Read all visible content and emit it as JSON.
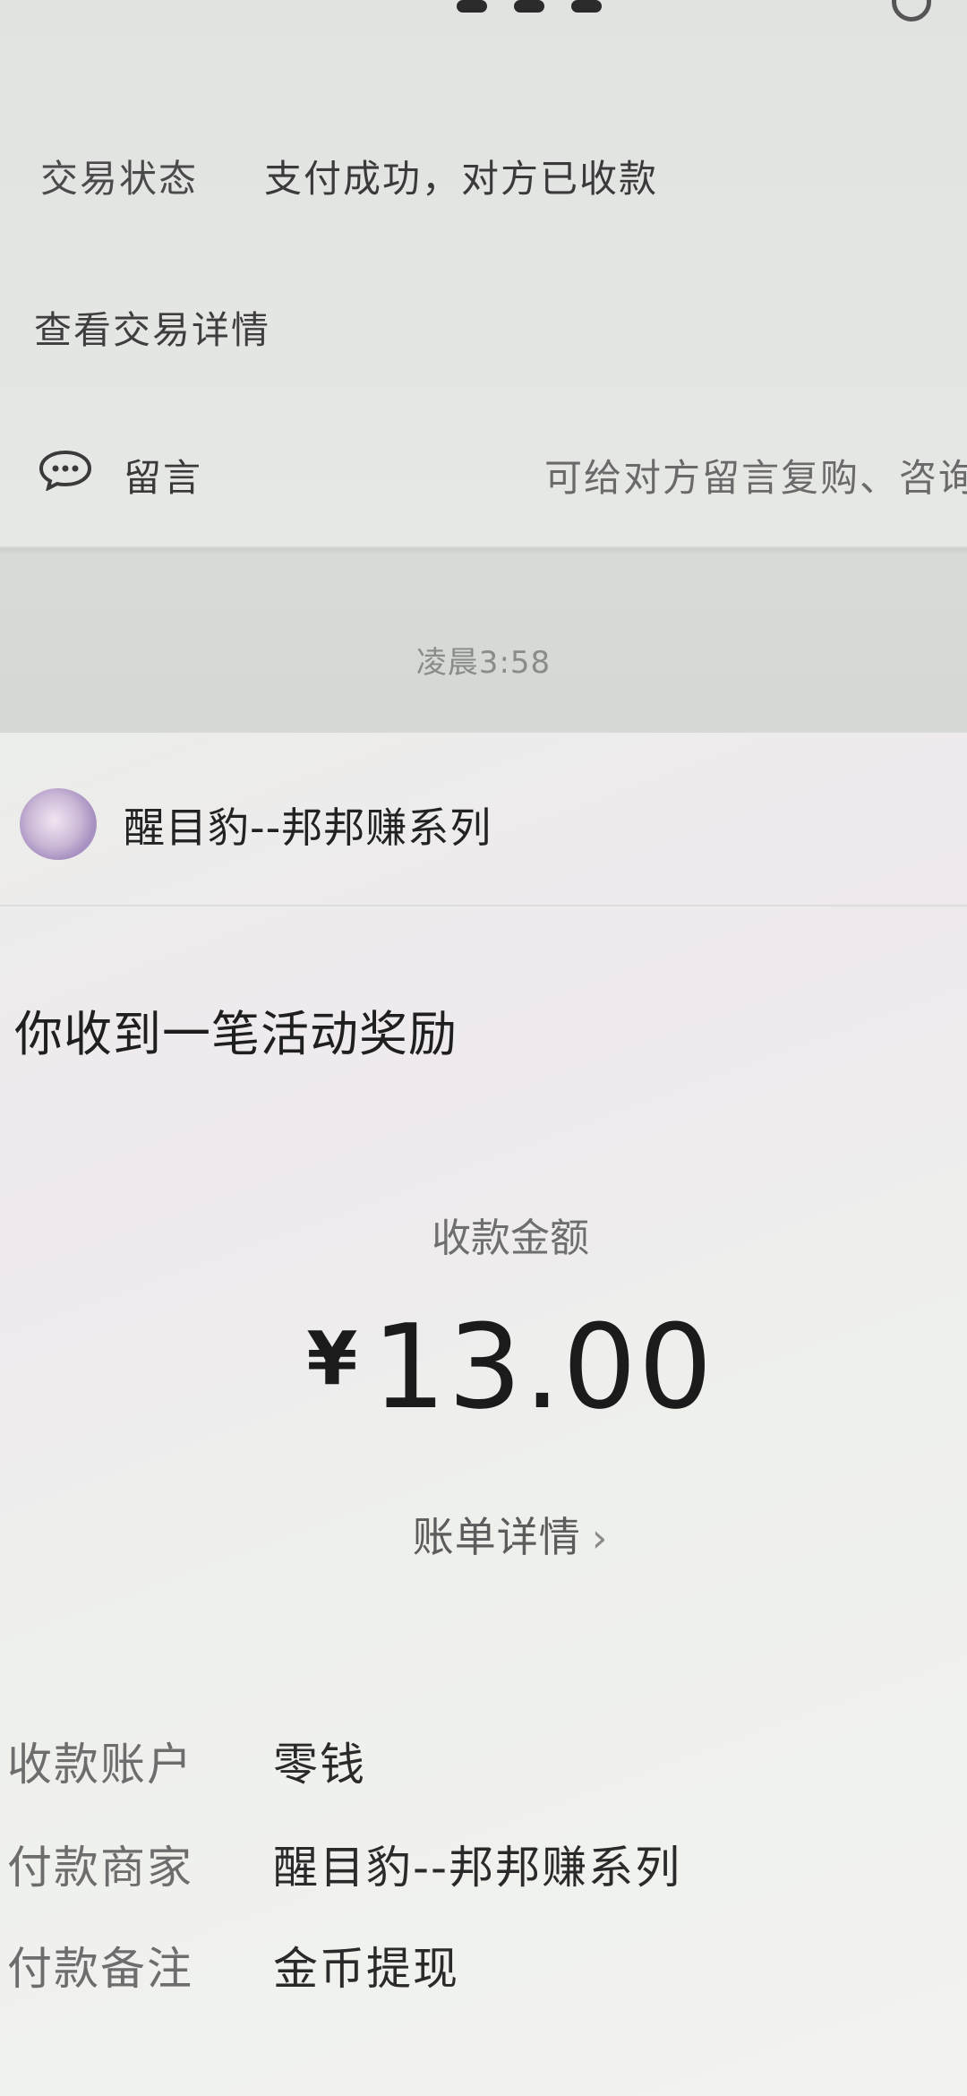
{
  "top_card": {
    "status_label": "交易状态",
    "status_value": "支付成功，对方已收款",
    "detail_link": "查看交易详情",
    "message_label": "留言",
    "message_hint": "可给对方留言复购、咨询",
    "message_icon": "chat-bubble-icon"
  },
  "timestamp": "凌晨3:58",
  "main_card": {
    "merchant_name": "醒目豹--邦邦赚系列",
    "avatar_icon": "avatar",
    "title": "你收到一笔活动奖励",
    "amount_label": "收款金额",
    "currency_symbol": "¥",
    "amount": "13.00",
    "bill_detail": "账单详情",
    "bill_detail_chevron": "›",
    "info": [
      {
        "label": "收款账户",
        "value": "零钱"
      },
      {
        "label": "付款商家",
        "value": "醒目豹--邦邦赚系列"
      },
      {
        "label": "付款备注",
        "value": "金币提现"
      }
    ]
  }
}
